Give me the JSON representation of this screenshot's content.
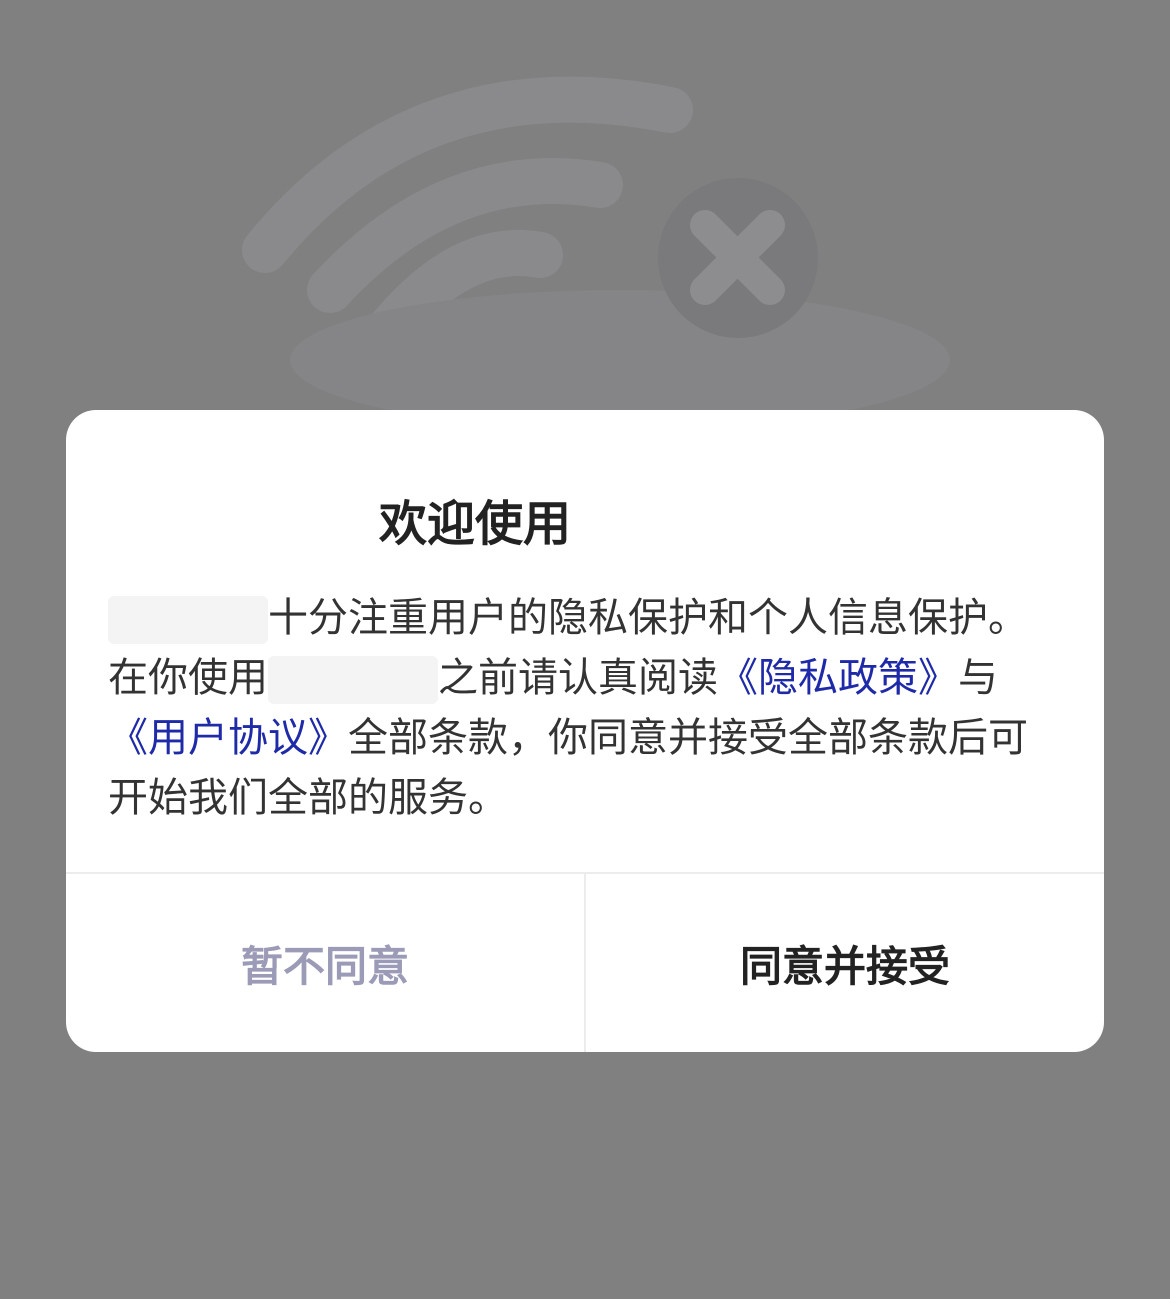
{
  "dialog": {
    "title_prefix": "欢迎使用",
    "body_part1": "十分注重用户的隐私保护和个人信息保护。在你使用",
    "body_part2": "之前请认真阅读",
    "privacy_link": "《隐私政策》",
    "connector": "与",
    "agreement_link": "《用户协议》",
    "body_part3": "全部条款，你同意并接受全部条款后可开始我们全部的服务。",
    "decline_label": "暂不同意",
    "accept_label": "同意并接受"
  },
  "background": {
    "icon": "wifi-disconnected-icon"
  },
  "colors": {
    "overlay": "#808080",
    "link": "#1e2aa8",
    "decline": "#9b9bb7",
    "text": "#333333"
  }
}
